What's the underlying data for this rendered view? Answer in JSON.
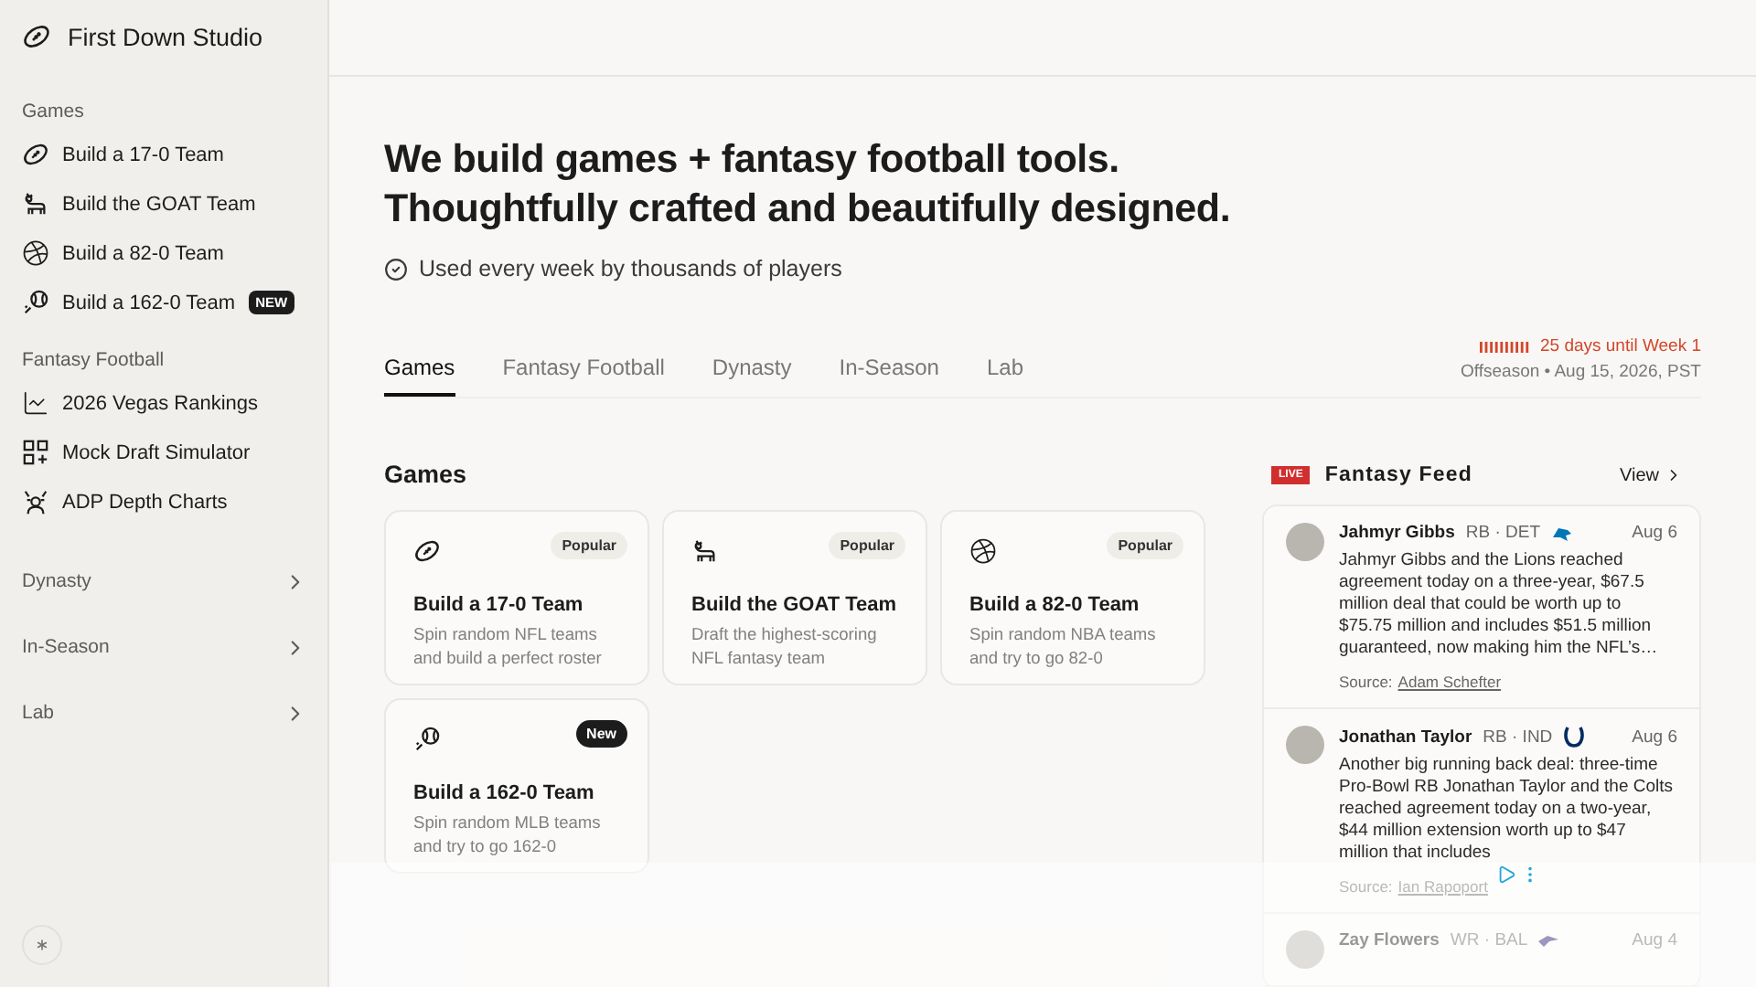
{
  "brand": {
    "name": "First Down Studio"
  },
  "sidebar": {
    "sections": [
      {
        "kind": "group",
        "label": "Games",
        "items": [
          {
            "label": "Build a 17-0 Team"
          },
          {
            "label": "Build the GOAT Team"
          },
          {
            "label": "Build a 82-0 Team"
          },
          {
            "label": "Build a 162-0 Team",
            "badge": "NEW"
          }
        ]
      },
      {
        "kind": "group",
        "label": "Fantasy Football",
        "items": [
          {
            "label": "2026 Vegas Rankings"
          },
          {
            "label": "Mock Draft Simulator"
          },
          {
            "label": "ADP Depth Charts"
          }
        ]
      },
      {
        "kind": "collapsible",
        "label": "Dynasty",
        "expanded": false
      },
      {
        "kind": "collapsible",
        "label": "In-Season",
        "expanded": false
      },
      {
        "kind": "collapsible",
        "label": "Lab",
        "expanded": false
      }
    ]
  },
  "hero": {
    "headline": [
      "We build games + fantasy football tools.",
      "Thoughtfully crafted and beautifully designed."
    ],
    "tagline": "Used every week by thousands of players"
  },
  "tabs": [
    {
      "label": "Games",
      "selected": true
    },
    {
      "label": "Fantasy Football",
      "selected": false
    },
    {
      "label": "Dynasty",
      "selected": false
    },
    {
      "label": "In-Season",
      "selected": false
    },
    {
      "label": "Lab",
      "selected": false
    }
  ],
  "countdown": {
    "text": "25 days until Week 1",
    "date": "Offseason • Aug 15, 2026, PST"
  },
  "games": {
    "title": "Games",
    "cards": [
      {
        "title": "Build a 17-0 Team",
        "description": "Spin random NFL teams and build a perfect roster",
        "badge": "Popular",
        "kind": "popular"
      },
      {
        "title": "Build the GOAT Team",
        "description": "Draft the highest-scoring NFL fantasy team",
        "badge": "Popular",
        "kind": "popular"
      },
      {
        "title": "Build a 82-0 Team",
        "description": "Spin random NBA teams and try to go 82-0",
        "badge": "Popular",
        "kind": "popular"
      },
      {
        "title": "Build a 162-0 Team",
        "description": "Spin random MLB teams and try to go 162-0",
        "badge": "New",
        "kind": "new"
      }
    ]
  },
  "feed": {
    "live": "LIVE",
    "title": "Fantasy Feed",
    "view": "View",
    "posts": [
      {
        "name": "Jahmyr Gibbs",
        "position": "RB · DET",
        "date": "Aug 6",
        "body": "Jahmyr Gibbs and the Lions reached agreement today on a three-year, $67.5 million deal that could be worth up to $75.75 million and includes $51.5 million guaranteed, now making him the NFL’s…",
        "source_label": "Source:",
        "source": "Adam Schefter"
      },
      {
        "name": "Jonathan Taylor",
        "position": "RB · IND",
        "date": "Aug 6",
        "body": "Another big running back deal: three-time Pro-Bowl RB Jonathan Taylor and the Colts reached agreement today on a two-year, $44 million extension worth up to $47 million that includes",
        "source_label": "Source:",
        "source": "Ian Rapoport"
      },
      {
        "name": "Zay Flowers",
        "position": "WR · BAL",
        "date": "Aug 4"
      }
    ]
  }
}
